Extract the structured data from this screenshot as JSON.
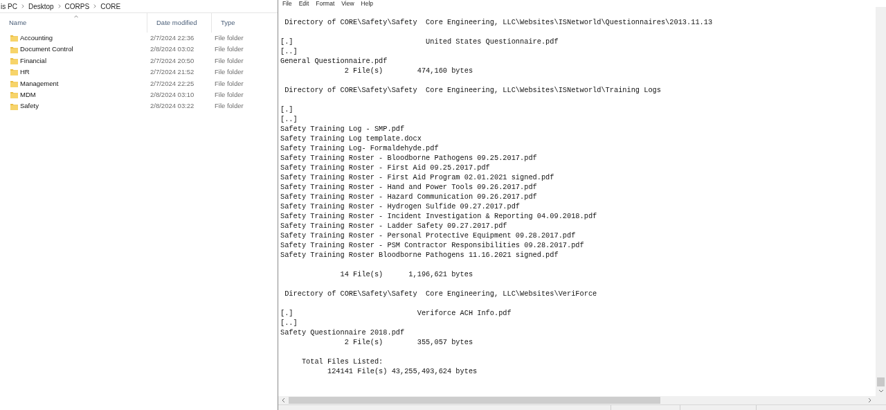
{
  "explorer": {
    "breadcrumb": [
      "is PC",
      "Desktop",
      "CORPS",
      "CORE"
    ],
    "columns": [
      "Name",
      "Date modified",
      "Type"
    ],
    "rows": [
      {
        "name": "Accounting",
        "date": "2/7/2024 22:36",
        "type": "File folder"
      },
      {
        "name": "Document Control",
        "date": "2/8/2024 03:02",
        "type": "File folder"
      },
      {
        "name": "Financial",
        "date": "2/7/2024 20:50",
        "type": "File folder"
      },
      {
        "name": "HR",
        "date": "2/7/2024 21:52",
        "type": "File folder"
      },
      {
        "name": "Management",
        "date": "2/7/2024 22:25",
        "type": "File folder"
      },
      {
        "name": "MDM",
        "date": "2/8/2024 03:10",
        "type": "File folder"
      },
      {
        "name": "Safety",
        "date": "2/8/2024 03:22",
        "type": "File folder"
      }
    ]
  },
  "notepad": {
    "menu": [
      "File",
      "Edit",
      "Format",
      "View",
      "Help"
    ],
    "paragraphs": [
      [
        " Directory of CORE\\Safety\\Safety  Core Engineering, LLC\\Websites\\ISNetworld\\Questionnaires\\2013.11.13"
      ],
      [
        "[.]                               United States Questionnaire.pdf",
        "[..]",
        "General Questionnaire.pdf",
        "               2 File(s)        474,160 bytes"
      ],
      [
        " Directory of CORE\\Safety\\Safety  Core Engineering, LLC\\Websites\\ISNetworld\\Training Logs"
      ],
      [
        "[.]",
        "[..]",
        "Safety Training Log - SMP.pdf",
        "Safety Training Log template.docx",
        "Safety Training Log- Formaldehyde.pdf",
        "Safety Training Roster - Bloodborne Pathogens 09.25.2017.pdf",
        "Safety Training Roster - First Aid 09.25.2017.pdf",
        "Safety Training Roster - First Aid Program 02.01.2021 signed.pdf",
        "Safety Training Roster - Hand and Power Tools 09.26.2017.pdf",
        "Safety Training Roster - Hazard Communication 09.26.2017.pdf",
        "Safety Training Roster - Hydrogen Sulfide 09.27.2017.pdf",
        "Safety Training Roster - Incident Investigation & Reporting 04.09.2018.pdf",
        "Safety Training Roster - Ladder Safety 09.27.2017.pdf",
        "Safety Training Roster - Personal Protective Equipment 09.28.2017.pdf",
        "Safety Training Roster - PSM Contractor Responsibilities 09.28.2017.pdf",
        "Safety Training Roster Bloodborne Pathogens 11.16.2021 signed.pdf"
      ],
      [
        "              14 File(s)      1,196,621 bytes"
      ],
      [
        " Directory of CORE\\Safety\\Safety  Core Engineering, LLC\\Websites\\VeriForce"
      ],
      [
        "[.]                             Veriforce ACH Info.pdf",
        "[..]",
        "Safety Questionnaire 2018.pdf",
        "               2 File(s)        355,057 bytes"
      ],
      [
        "     Total Files Listed:",
        "           124141 File(s) 43,255,493,624 bytes"
      ]
    ]
  }
}
